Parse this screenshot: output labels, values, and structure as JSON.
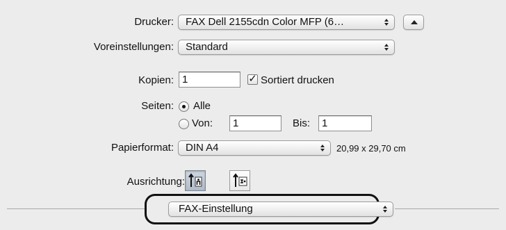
{
  "printer": {
    "label": "Drucker:",
    "value": "FAX Dell 2155cdn Color MFP (6…",
    "expand_icon": "disclosure-up-icon"
  },
  "presets": {
    "label": "Voreinstellungen:",
    "value": "Standard"
  },
  "copies": {
    "label": "Kopien:",
    "value": "1",
    "collate_checked": true,
    "collate_label": "Sortiert drucken"
  },
  "pages": {
    "label": "Seiten:",
    "all_label": "Alle",
    "all_selected": true,
    "from_label": "Von:",
    "from_value": "1",
    "to_label": "Bis:",
    "to_value": "1"
  },
  "paper": {
    "label": "Papierformat:",
    "value": "DIN A4",
    "size_text": "20,99 x 29,70 cm"
  },
  "orientation": {
    "label": "Ausrichtung:",
    "options": [
      "portrait",
      "landscape"
    ],
    "selected": "portrait"
  },
  "section": {
    "value": "FAX-Einstellung"
  }
}
